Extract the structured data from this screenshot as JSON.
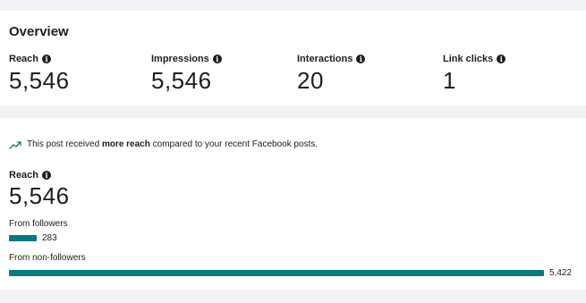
{
  "overview": {
    "title": "Overview",
    "metrics": [
      {
        "label": "Reach",
        "value": "5,546"
      },
      {
        "label": "Impressions",
        "value": "5,546"
      },
      {
        "label": "Interactions",
        "value": "20"
      },
      {
        "label": "Link clicks",
        "value": "1"
      }
    ]
  },
  "reach_section": {
    "insight": {
      "prefix": "This post received ",
      "emphasis": "more reach",
      "suffix": " compared to your recent Facebook posts."
    },
    "label": "Reach",
    "value": "5,546",
    "sources": [
      {
        "label": "From followers",
        "value_text": "283",
        "value": 283
      },
      {
        "label": "From non-followers",
        "value_text": "5,422",
        "value": 5422
      }
    ]
  },
  "colors": {
    "bar": "#0a7a7f",
    "trend_icon": "#0a7a7f",
    "info_icon": "#1c1e21"
  },
  "icons": {
    "info": "info-icon",
    "trend": "trending-up-icon"
  }
}
